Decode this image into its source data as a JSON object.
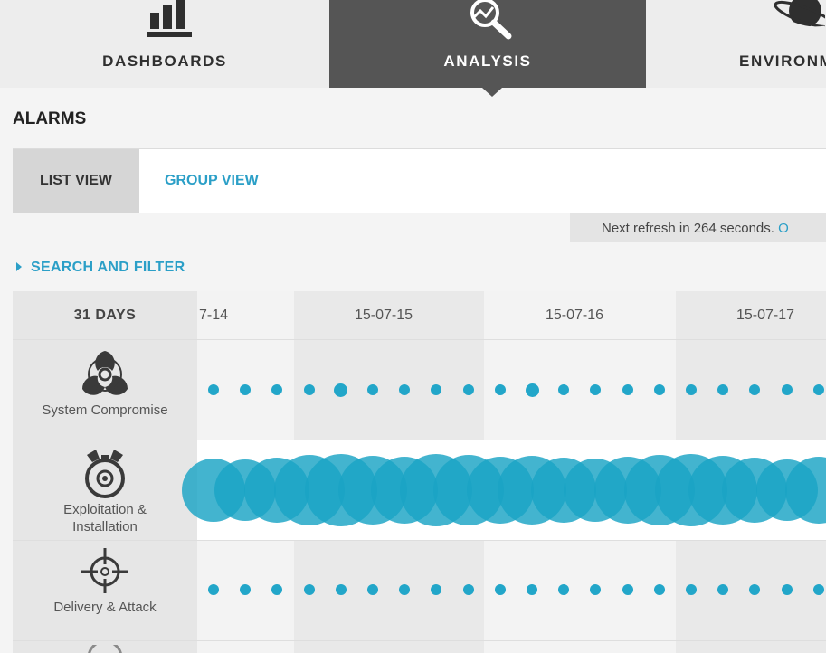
{
  "nav": {
    "tabs": [
      {
        "label": "DASHBOARDS",
        "icon": "bar-chart-icon"
      },
      {
        "label": "ANALYSIS",
        "icon": "magnify-analysis-icon",
        "active": true
      },
      {
        "label": "ENVIRONM",
        "icon": "planet-icon"
      }
    ]
  },
  "page": {
    "title": "ALARMS"
  },
  "views": {
    "list": "LIST VIEW",
    "group": "GROUP VIEW"
  },
  "refresh": {
    "text": "Next refresh in 264 seconds.",
    "link": "O"
  },
  "filter": {
    "label": "SEARCH AND FILTER"
  },
  "timeline": {
    "range_label": "31 DAYS",
    "dates": [
      "7-14",
      "15-07-15",
      "15-07-16",
      "15-07-17"
    ],
    "categories": [
      {
        "label_lines": [
          "System Compromise"
        ],
        "icon": "biohazard-icon",
        "display": "dots"
      },
      {
        "label_lines": [
          "Exploitation &",
          "Installation"
        ],
        "icon": "bomb-icon",
        "display": "bubbles"
      },
      {
        "label_lines": [
          "Delivery & Attack"
        ],
        "icon": "crosshair-icon",
        "display": "dots"
      }
    ]
  },
  "colors": {
    "accent": "#2b9fc7",
    "dot": "#22a6c9",
    "nav_active": "#555555"
  }
}
